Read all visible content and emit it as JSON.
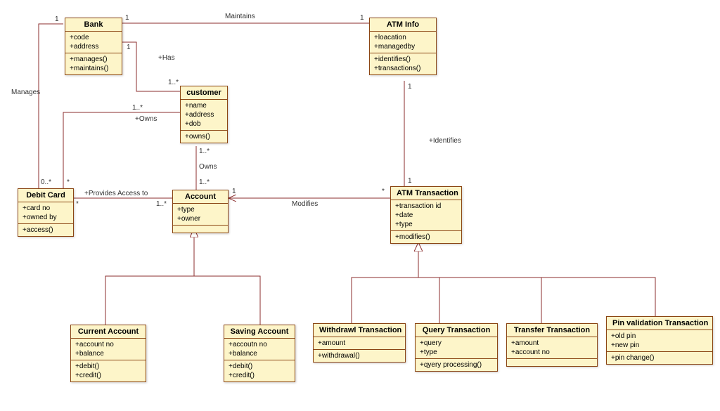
{
  "diagram_type": "UML Class Diagram",
  "classes": {
    "bank": {
      "name": "Bank",
      "attrs": [
        "+code",
        "+address"
      ],
      "ops": [
        "+manages()",
        "+maintains()"
      ]
    },
    "customer": {
      "name": "customer",
      "attrs": [
        "+name",
        "+address",
        "+dob"
      ],
      "ops": [
        "+owns()"
      ]
    },
    "atm_info": {
      "name": "ATM Info",
      "attrs": [
        "+loacation",
        "+managedby"
      ],
      "ops": [
        "+identifies()",
        "+transactions()"
      ]
    },
    "debit_card": {
      "name": "Debit Card",
      "attrs": [
        "+card no",
        "+owned by"
      ],
      "ops": [
        "+access()"
      ]
    },
    "account": {
      "name": "Account",
      "attrs": [
        "+type",
        "+owner"
      ],
      "ops": []
    },
    "atm_transaction": {
      "name": "ATM Transaction",
      "attrs": [
        "+transaction id",
        "+date",
        "+type"
      ],
      "ops": [
        "+modifies()"
      ]
    },
    "current_account": {
      "name": "Current Account",
      "attrs": [
        "+account no",
        "+balance"
      ],
      "ops": [
        "+debit()",
        "+credit()"
      ]
    },
    "saving_account": {
      "name": "Saving Account",
      "attrs": [
        "+accoutn no",
        "+balance"
      ],
      "ops": [
        "+debit()",
        "+credit()"
      ]
    },
    "withdrawal": {
      "name": "Withdrawl Transaction",
      "attrs": [
        "+amount"
      ],
      "ops": [
        "+withdrawal()"
      ]
    },
    "query": {
      "name": "Query Transaction",
      "attrs": [
        "+query",
        "+type"
      ],
      "ops": [
        "+qyery processing()"
      ]
    },
    "transfer": {
      "name": "Transfer Transaction",
      "attrs": [
        "+amount",
        "+account no"
      ],
      "ops": []
    },
    "pin_validation": {
      "name": "Pin validation Transaction",
      "attrs": [
        "+old pin",
        "+new pin"
      ],
      "ops": [
        "+pin change()"
      ]
    }
  },
  "labels": {
    "maintains": "Maintains",
    "has": "+Has",
    "manages": "Manages",
    "owns_h": "+Owns",
    "owns_v": "Owns",
    "provides": "+Provides Access to",
    "modifies": "Modifies",
    "identifies": "+Identifies",
    "m_1a": "1",
    "m_1b": "1",
    "m_1c": "1",
    "m_1d": "1",
    "m_1e": "1",
    "m_1f": "1",
    "m_1g": "1",
    "m_0s": "0..*",
    "m_star": "*",
    "m_star2": "*",
    "m_star3": "*",
    "m_1s": "1..*",
    "m_1s2": "1..*",
    "m_1s3": "1..*",
    "m_1s4": "1..*",
    "m_1s5": "1..*"
  },
  "chart_data": {
    "type": "table",
    "description": "UML class diagram associations",
    "associations": [
      {
        "from": "Bank",
        "to": "ATM Info",
        "label": "Maintains",
        "from_mult": "1",
        "to_mult": "1"
      },
      {
        "from": "Bank",
        "to": "customer",
        "label": "Has",
        "from_mult": "1",
        "to_mult": "1..*"
      },
      {
        "from": "Bank",
        "to": "Debit Card",
        "label": "Manages",
        "from_mult": "1",
        "to_mult": "0..*"
      },
      {
        "from": "customer",
        "to": "Debit Card",
        "label": "Owns",
        "from_mult": "1..*",
        "to_mult": "*"
      },
      {
        "from": "customer",
        "to": "Account",
        "label": "Owns",
        "from_mult": "1..*",
        "to_mult": "1..*"
      },
      {
        "from": "Debit Card",
        "to": "Account",
        "label": "Provides Access to",
        "from_mult": "*",
        "to_mult": "1..*"
      },
      {
        "from": "ATM Transaction",
        "to": "Account",
        "label": "Modifies",
        "from_mult": "*",
        "to_mult": "1",
        "nav_to": "Account"
      },
      {
        "from": "ATM Info",
        "to": "ATM Transaction",
        "label": "Identifies",
        "from_mult": "1",
        "to_mult": "*"
      }
    ],
    "generalizations": [
      {
        "parent": "Account",
        "children": [
          "Current Account",
          "Saving Account"
        ]
      },
      {
        "parent": "ATM Transaction",
        "children": [
          "Withdrawl Transaction",
          "Query Transaction",
          "Transfer Transaction",
          "Pin validation Transaction"
        ]
      }
    ]
  }
}
